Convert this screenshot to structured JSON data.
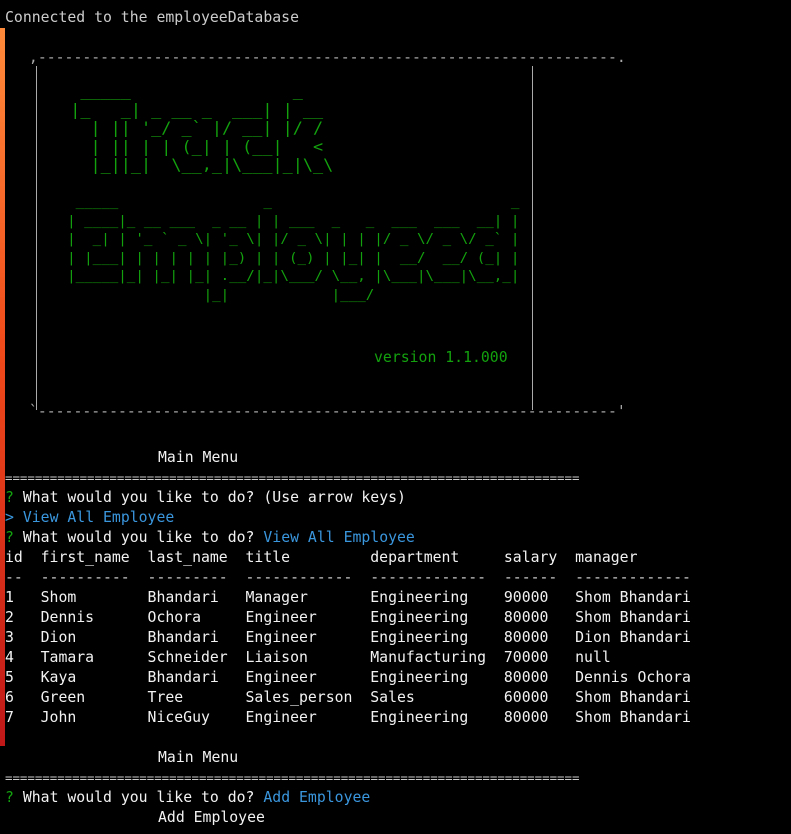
{
  "terminal": {
    "connected": "Connected to the employeeDatabase",
    "banner": {
      "top": " ,-----------------------------------------------------------------.",
      "art_lines": [
        "   _____                _    ",
        "  |_   _| _ __ _  ___| | __",
        "    | || '_/ _` |/ __| |/ /",
        "    | || | | (_| | (__|   < ",
        "    |_||_|  \\__,_|\\___|_|\\_\\",
        "",
        "   _____                 _                            _ ",
        "  | ____|_ __ ___  _ __ | | ___  _   _  ___  ___  __| |",
        "  |  _| | '_ ` _ \\| '_ \\| |/ _ \\| | | |/ _ \\/ _ \\/ _` |",
        "  | |___| | | | | | |_) | | (_) | |_| |  __/  __/ (_| |",
        "  |_____|_| |_| |_| .__/|_|\\___/ \\__, |\\___|\\___|\\__,_|",
        "                  |_|            |___/                  "
      ],
      "version": "version 1.1.000",
      "bottom": " `-----------------------------------------------------------------'"
    },
    "menu_title": "Main Menu",
    "separator": "=============================================================================",
    "prompt_mark": "?",
    "question": "What would you like to do?",
    "hint": "(Use arrow keys)",
    "pointer": ">",
    "highlighted_choice": "View All Employee",
    "answer1": "View All Employee",
    "table": {
      "header": "id  first_name  last_name  title         department     salary  manager",
      "divider": "--  ----------  ---------  ------------  -------------  ------  -------------",
      "rows": [
        "1   Shom        Bhandari   Manager       Engineering    90000   Shom Bhandari",
        "2   Dennis      Ochora     Engineer      Engineering    80000   Shom Bhandari",
        "3   Dion        Bhandari   Engineer      Engineering    80000   Dion Bhandari",
        "4   Tamara      Schneider  Liaison       Manufacturing  70000   null",
        "5   Kaya        Bhandari   Engineer      Engineering    80000   Dennis Ochora",
        "6   Green       Tree       Sales_person  Sales          60000   Shom Bhandari",
        "7   John        NiceGuy    Engineer      Engineering    80000   Shom Bhandari"
      ]
    },
    "answer2": "Add Employee",
    "add_title": "Add Employee"
  }
}
